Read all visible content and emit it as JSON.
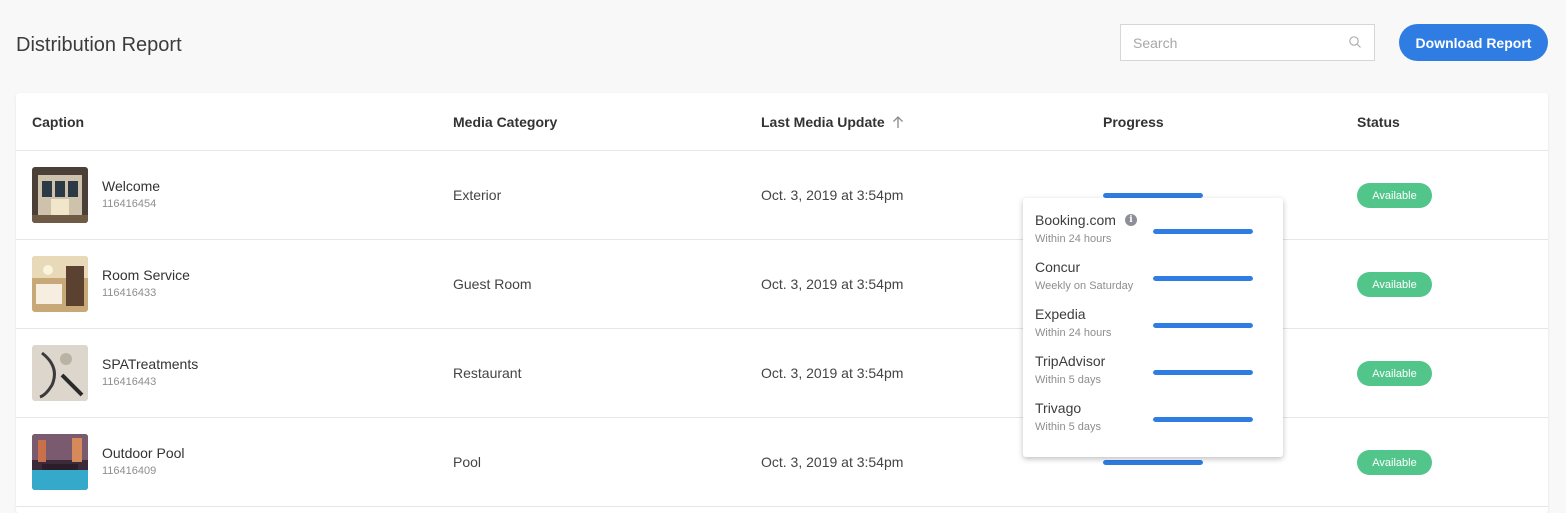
{
  "page": {
    "title": "Distribution Report"
  },
  "search": {
    "placeholder": "Search",
    "value": ""
  },
  "actions": {
    "download_label": "Download Report"
  },
  "colors": {
    "accent": "#2f7de3",
    "status_available": "#52c58b"
  },
  "table": {
    "columns": [
      "Caption",
      "Media Category",
      "Last Media Update",
      "Progress",
      "Status"
    ],
    "sorted_column": "Last Media Update",
    "sort_direction": "ascending",
    "rows": [
      {
        "caption": "Welcome",
        "id": "116416454",
        "category": "Exterior",
        "updated": "Oct. 3, 2019 at 3:54pm",
        "progress": 1.0,
        "status": "Available",
        "thumb_icon": "hotel-exterior-thumbnail"
      },
      {
        "caption": "Room Service",
        "id": "116416433",
        "category": "Guest Room",
        "updated": "Oct. 3, 2019 at 3:54pm",
        "progress": 1.0,
        "status": "Available",
        "thumb_icon": "room-service-thumbnail"
      },
      {
        "caption": "SPATreatments",
        "id": "116416443",
        "category": "Restaurant",
        "updated": "Oct. 3, 2019 at 3:54pm",
        "progress": 1.0,
        "status": "Available",
        "thumb_icon": "spa-treatment-thumbnail"
      },
      {
        "caption": "Outdoor Pool",
        "id": "116416409",
        "category": "Pool",
        "updated": "Oct. 3, 2019 at 3:54pm",
        "progress": 1.0,
        "status": "Available",
        "thumb_icon": "outdoor-pool-thumbnail"
      }
    ]
  },
  "popover": {
    "channels": [
      {
        "name": "Booking.com",
        "schedule": "Within 24 hours",
        "progress": 1.0,
        "info": true
      },
      {
        "name": "Concur",
        "schedule": "Weekly on Saturday",
        "progress": 1.0,
        "info": false
      },
      {
        "name": "Expedia",
        "schedule": "Within 24 hours",
        "progress": 1.0,
        "info": false
      },
      {
        "name": "TripAdvisor",
        "schedule": "Within 5 days",
        "progress": 1.0,
        "info": false
      },
      {
        "name": "Trivago",
        "schedule": "Within 5 days",
        "progress": 1.0,
        "info": false
      }
    ]
  }
}
